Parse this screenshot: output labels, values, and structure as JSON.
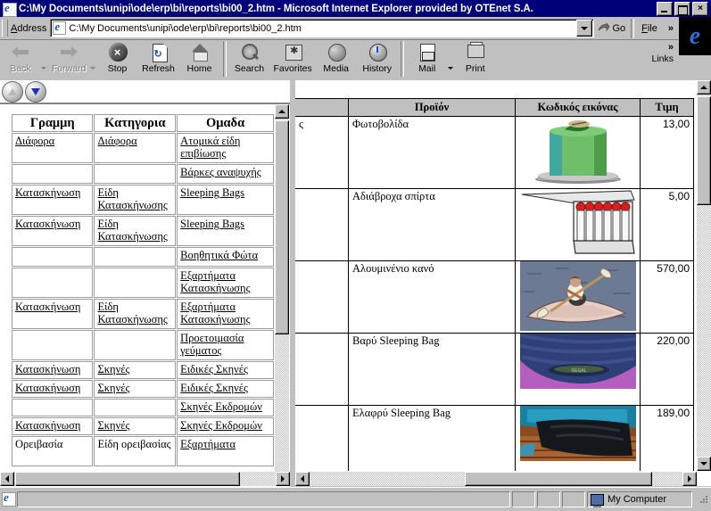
{
  "window": {
    "title": "C:\\My Documents\\unipi\\ode\\erp\\bi\\reports\\bi00_2.htm - Microsoft Internet Explorer provided by OTEnet S.A.",
    "app_icon": "ie-document-icon",
    "minimize_label": "",
    "restore_label": "",
    "close_label": "×"
  },
  "address_bar": {
    "label": "Address",
    "value": "C:\\My Documents\\unipi\\ode\\erp\\bi\\reports\\bi00_2.htm",
    "placeholder": "",
    "go_label": "Go",
    "file_menu_label": "File",
    "overflow_chevron": "»"
  },
  "toolbar": {
    "items": [
      {
        "label": "Back",
        "icon": "back-arrow-icon",
        "disabled": true,
        "has_dropdown": true
      },
      {
        "label": "Forward",
        "icon": "forward-arrow-icon",
        "disabled": true,
        "has_dropdown": true
      },
      {
        "label": "Stop",
        "icon": "stop-icon",
        "disabled": false,
        "has_dropdown": false
      },
      {
        "label": "Refresh",
        "icon": "refresh-icon",
        "disabled": false,
        "has_dropdown": false
      },
      {
        "label": "Home",
        "icon": "home-icon",
        "disabled": false,
        "has_dropdown": false
      },
      {
        "label": "Search",
        "icon": "search-icon",
        "disabled": false,
        "has_dropdown": false
      },
      {
        "label": "Favorites",
        "icon": "favorites-icon",
        "disabled": false,
        "has_dropdown": false
      },
      {
        "label": "Media",
        "icon": "media-icon",
        "disabled": false,
        "has_dropdown": false
      },
      {
        "label": "History",
        "icon": "history-icon",
        "disabled": false,
        "has_dropdown": false
      },
      {
        "label": "Mail",
        "icon": "mail-icon",
        "disabled": false,
        "has_dropdown": true
      },
      {
        "label": "Print",
        "icon": "print-icon",
        "disabled": false,
        "has_dropdown": false
      }
    ],
    "links_label": "Links",
    "links_chevron": "»",
    "toolbar_chevron": "»"
  },
  "left_frame": {
    "nav": {
      "up_button": "scroll-up-circle-icon",
      "down_button": "scroll-down-circle-icon"
    },
    "table": {
      "headers": [
        "Γραμμη",
        "Κατηγορια",
        "Ομαδα"
      ],
      "rows": [
        [
          "Διάφορα",
          "Διάφορα",
          "Ατομικά είδη επιβίωσης"
        ],
        [
          "",
          "",
          "Βάρκες αναψυχής"
        ],
        [
          "Κατασκήνωση",
          "Είδη Κατασκήνωσης",
          "Sleeping Bags"
        ],
        [
          "Κατασκήνωση",
          "Είδη Κατασκήνωσης",
          "Sleeping Bags"
        ],
        [
          "",
          "",
          "Βοηθητικά Φώτα"
        ],
        [
          "",
          "",
          "Εξαρτήματα Κατασκήνωσης"
        ],
        [
          "Κατασκήνωση",
          "Είδη Κατασκήνωσης",
          "Εξαρτήματα Κατασκήνωσης"
        ],
        [
          "",
          "",
          "Προετοιμασία γεύματος"
        ],
        [
          "Κατασκήνωση",
          "Σκηνές",
          "Ειδικές Σκηνές"
        ],
        [
          "Κατασκήνωση",
          "Σκηνές",
          "Ειδικές Σκηνές"
        ],
        [
          "",
          "",
          "Σκηνές Εκδρομών"
        ],
        [
          "Κατασκήνωση",
          "Σκηνές",
          "Σκηνές Εκδρομών"
        ],
        [
          "Ορειβασία",
          "Είδη ορειβασίας",
          "Εξαρτήματα"
        ]
      ]
    }
  },
  "right_frame": {
    "table": {
      "headers": [
        "",
        "Προϊόν",
        "Κωδικός εικόνας",
        "Τιμη"
      ],
      "rows": [
        {
          "first": "ς",
          "product": "Φωτοβολίδα",
          "image": "flare-product-image",
          "price": "13,00"
        },
        {
          "first": "",
          "product": "Αδιάβροχα σπίρτα",
          "image": "waterproof-matches-image",
          "price": "5,00"
        },
        {
          "first": "",
          "product": "Αλουμινένιο κανό",
          "image": "kayak-image",
          "price": "570,00"
        },
        {
          "first": "",
          "product": "Βαρύ Sleeping Bag",
          "image": "heavy-sleeping-bag-image",
          "price": "220,00"
        },
        {
          "first": "",
          "product": "Ελαφρύ Sleeping Bag",
          "image": "light-sleeping-bag-image",
          "price": "189,00"
        }
      ]
    }
  },
  "status_bar": {
    "message": "",
    "zone_icon": "my-computer-icon",
    "zone_label": "My Computer"
  }
}
